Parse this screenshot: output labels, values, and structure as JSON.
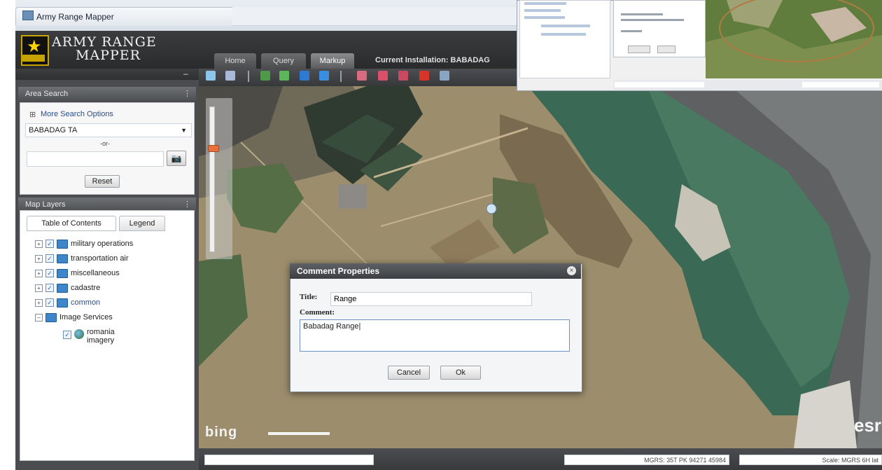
{
  "window": {
    "title": "Army Range Mapper"
  },
  "header": {
    "brand_line1": "ARMY RANGE",
    "brand_line2": "MAPPER",
    "tabs": [
      {
        "label": "Home"
      },
      {
        "label": "Query"
      },
      {
        "label": "Markup",
        "active": true
      }
    ],
    "current_installation": "Current Installation: BABADAG"
  },
  "left_panel": {
    "area_search": {
      "title": "Area Search",
      "more_link": "More Search Options",
      "selected_installation": "BABADAG TA",
      "input_label": "-or-",
      "input_value": "",
      "reset_label": "Reset"
    },
    "map_layers": {
      "title": "Map Layers",
      "tabs": [
        {
          "label": "Table of Contents",
          "active": true
        },
        {
          "label": "Legend"
        }
      ],
      "items": [
        {
          "label": "military operations",
          "checked": true
        },
        {
          "label": "transportation air",
          "checked": true
        },
        {
          "label": "miscellaneous",
          "checked": true
        },
        {
          "label": "cadastre",
          "checked": true
        },
        {
          "label": "common",
          "checked": true
        }
      ],
      "image_services": {
        "label": "Image Services",
        "child_line1": "romania",
        "child_line2": "imagery"
      }
    }
  },
  "dialog": {
    "title": "Comment Properties",
    "title_label": "Title:",
    "title_value": "Range",
    "comment_label": "Comment:",
    "comment_value": "Babadag Range|",
    "cancel_label": "Cancel",
    "ok_label": "Ok"
  },
  "map": {
    "bing_logo": "bing",
    "esri_logo": "esri",
    "zoom_level_fraction": 0.29
  },
  "status": {
    "coordinate": "MGRS: 35T PK 94271 45984",
    "scale": "Scale: MGRS 6H lat"
  },
  "colors": {
    "header_bg": "#2f3032",
    "panel_bg": "#4a4c4f",
    "water": "#3d6a56",
    "zoom_thumb": "#e8703a"
  }
}
